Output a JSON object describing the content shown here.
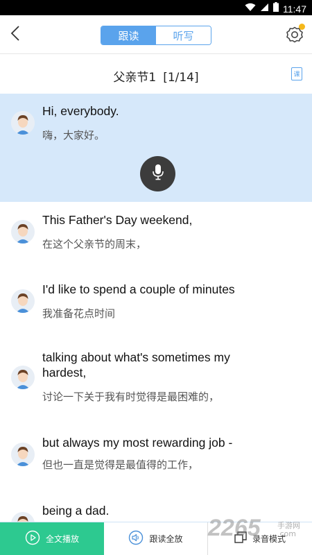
{
  "status_bar": {
    "time": "11:47",
    "icons": [
      "wifi-icon",
      "signal-icon",
      "battery-icon"
    ]
  },
  "nav": {
    "back_icon": "chevron-left-icon",
    "tabs": [
      {
        "label": "跟读",
        "active": true
      },
      {
        "label": "听写",
        "active": false
      }
    ],
    "settings_icon": "gear-icon",
    "accent_color": "#5aa3ec",
    "notify_color": "#f5b81a"
  },
  "lesson": {
    "title": "父亲节1",
    "progress": "[1/14]",
    "icon_label": "课"
  },
  "sentences": [
    {
      "en": "Hi, everybody.",
      "zh": "嗨，大家好。",
      "active": true
    },
    {
      "en": "This Father's Day weekend,",
      "zh": "在这个父亲节的周末，",
      "active": false
    },
    {
      "en": "I'd like to spend a couple of minutes",
      "zh": "我准备花点时间",
      "active": false
    },
    {
      "en": "talking about what's sometimes my hardest,",
      "zh": "讨论一下关于我有时觉得是最困难的，",
      "active": false
    },
    {
      "en": "but always my most rewarding job -",
      "zh": "但也一直是觉得是最值得的工作，",
      "active": false
    },
    {
      "en": "being a dad.",
      "zh": "",
      "active": false
    }
  ],
  "mic_icon": "microphone-icon",
  "bottom_bar": {
    "play_all": {
      "label": "全文播放",
      "icon": "play-circle-icon",
      "color": "#2dc990"
    },
    "follow_all": {
      "label": "跟读全放",
      "icon": "speaker-icon"
    },
    "record_mode": {
      "label": "录音模式",
      "icon": "record-mode-icon"
    }
  },
  "watermark": {
    "main": "2265",
    "sub_line1": "手游网",
    "sub_line2": ".com"
  }
}
